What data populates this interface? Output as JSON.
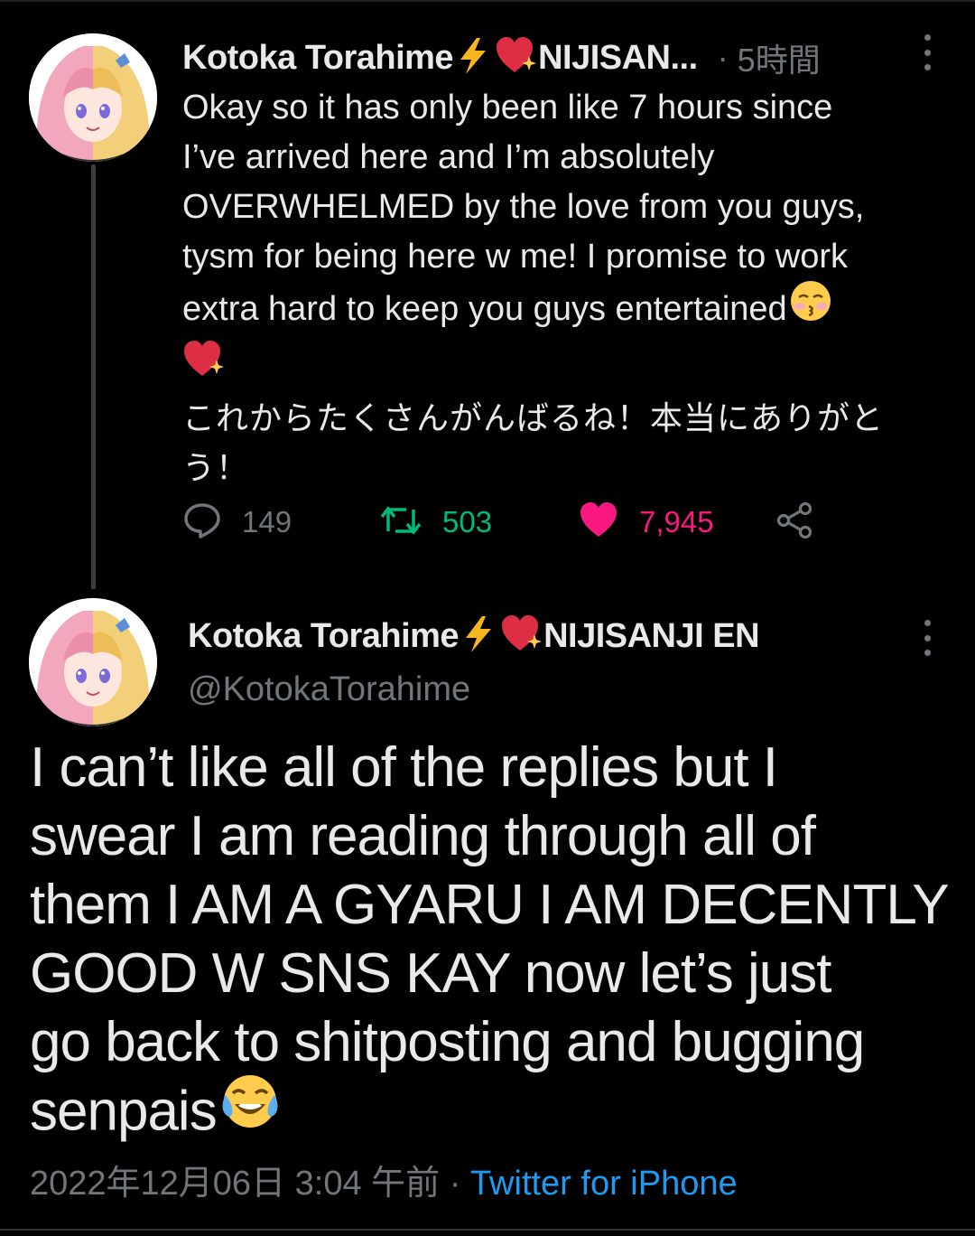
{
  "colors": {
    "background": "#000000",
    "text_primary": "#e7e9ea",
    "text_secondary": "#71767b",
    "retweet_green": "#00ba7c",
    "like_pink": "#f91880",
    "link_blue": "#1d9bf0"
  },
  "parent_tweet": {
    "display_name": "Kotoka Torahime",
    "name_suffix": "NIJISAN...",
    "name_emojis": [
      "high-voltage-emoji",
      "sparkling-heart-emoji"
    ],
    "separator": "·",
    "time": "5時間",
    "body_lines": [
      "Okay so it has only been like 7 hours since",
      "I’ve arrived here and I’m absolutely",
      "OVERWHELMED by the love from you guys,",
      "tysm for being here w me! I promise to work",
      "extra hard to keep you guys entertained"
    ],
    "body_emojis": [
      "kissing-face-with-closed-eyes-emoji",
      "sparkling-heart-emoji"
    ],
    "japanese_lines": [
      "これからたくさんがんばるね！本当にありがと",
      "う！"
    ],
    "actions": {
      "reply_icon": "reply-bubble-icon",
      "reply_count": "149",
      "retweet_icon": "retweet-icon",
      "retweet_count": "503",
      "like_icon": "heart-filled-icon",
      "like_count": "7,945",
      "share_icon": "share-icon"
    }
  },
  "main_tweet": {
    "display_name": "Kotoka Torahime",
    "name_suffix": "NIJISANJI EN",
    "name_emojis": [
      "high-voltage-emoji",
      "sparkling-heart-emoji"
    ],
    "handle": "@KotokaTorahime",
    "body_lines": [
      "I can’t like all of the replies but I",
      "swear I am reading through all of",
      "them I AM A GYARU I AM DECENTLY",
      "GOOD W SNS KAY now let’s just",
      "go back to shitposting and bugging",
      "senpais"
    ],
    "body_emojis": [
      "face-with-tears-of-joy-emoji"
    ],
    "timestamp": "2022年12月06日 3:04 午前",
    "separator": " · ",
    "source": "Twitter for iPhone"
  }
}
